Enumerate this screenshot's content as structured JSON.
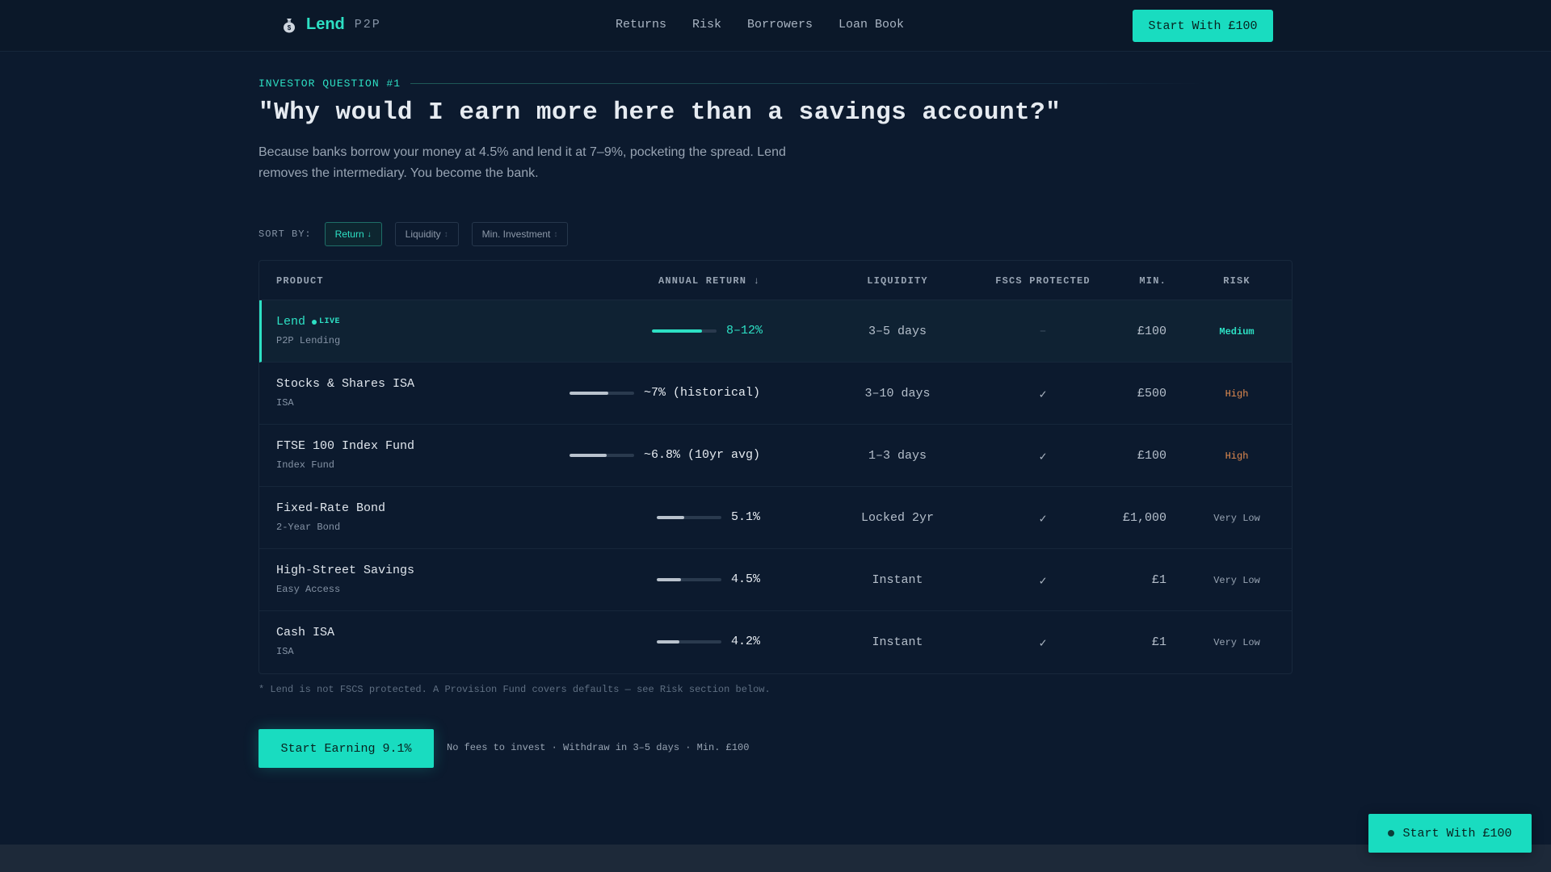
{
  "nav": {
    "brand_name": "Lend",
    "brand_tag": "P2P",
    "brand_icon": "money-bag-icon",
    "links": [
      "Returns",
      "Risk",
      "Borrowers",
      "Loan Book"
    ],
    "cta_label": "Start With £100"
  },
  "hero": {
    "eyebrow": "INVESTOR QUESTION #1",
    "headline": "\"Why would I earn more here than a savings account?\"",
    "subcopy": "Because banks borrow your money at 4.5% and lend it at 7–9%, pocketing the spread. Lend removes the intermediary. You become the bank."
  },
  "sort": {
    "label": "SORT BY:",
    "options": [
      {
        "label": "Return",
        "arrow": "↓",
        "active": true
      },
      {
        "label": "Liquidity",
        "arrow": "↕",
        "active": false
      },
      {
        "label": "Min. Investment",
        "arrow": "↕",
        "active": false
      }
    ]
  },
  "table": {
    "headers": {
      "product": "PRODUCT",
      "annual_return": "ANNUAL RETURN ↓",
      "liquidity": "LIQUIDITY",
      "fscs": "FSCS PROTECTED",
      "min": "MIN.",
      "risk": "RISK"
    },
    "rows": [
      {
        "name": "Lend",
        "badge": "LIVE",
        "category": "P2P Lending",
        "return_label": "8–12%",
        "return_bar": 0.77,
        "liquidity": "3–5 days",
        "fscs": "–",
        "min": "£100",
        "risk": "Medium",
        "featured": true
      },
      {
        "name": "Stocks & Shares ISA",
        "category": "ISA",
        "return_label": "~7% (historical)",
        "return_bar": 0.6,
        "liquidity": "3–10 days",
        "fscs": "✓",
        "min": "£500",
        "risk": "High"
      },
      {
        "name": "FTSE 100 Index Fund",
        "category": "Index Fund",
        "return_label": "~6.8% (10yr avg)",
        "return_bar": 0.57,
        "liquidity": "1–3 days",
        "fscs": "✓",
        "min": "£100",
        "risk": "High"
      },
      {
        "name": "Fixed-Rate Bond",
        "category": "2-Year Bond",
        "return_label": "5.1%",
        "return_bar": 0.43,
        "liquidity": "Locked 2yr",
        "fscs": "✓",
        "min": "£1,000",
        "risk": "Very Low"
      },
      {
        "name": "High-Street Savings",
        "category": "Easy Access",
        "return_label": "4.5%",
        "return_bar": 0.38,
        "liquidity": "Instant",
        "fscs": "✓",
        "min": "£1",
        "risk": "Very Low"
      },
      {
        "name": "Cash ISA",
        "category": "ISA",
        "return_label": "4.2%",
        "return_bar": 0.35,
        "liquidity": "Instant",
        "fscs": "✓",
        "min": "£1",
        "risk": "Very Low"
      }
    ]
  },
  "footnote": "* Lend is not FSCS protected. A Provision Fund covers defaults — see Risk section below.",
  "cta": {
    "label": "Start Earning 9.1%",
    "note": "No fees to invest · Withdraw in 3–5 days · Min. £100"
  },
  "floating_cta": {
    "label": "Start With £100"
  },
  "colors": {
    "accent": "#19dcc0",
    "background": "#0c1a2e",
    "risk_high": "#e08a4f"
  }
}
